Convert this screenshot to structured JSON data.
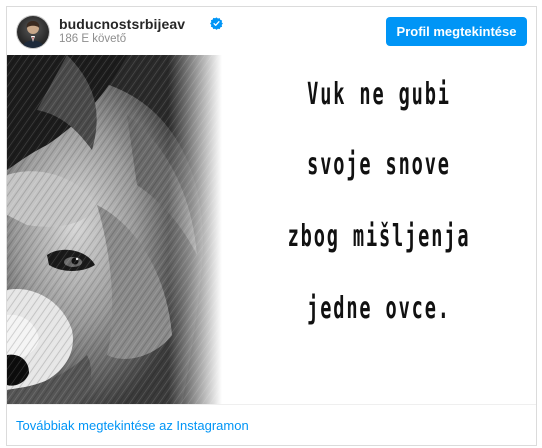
{
  "header": {
    "username": "buducnostsrbijeav",
    "followers": "186 E követő",
    "profile_button": "Profil megtekintése"
  },
  "post": {
    "quote_lines": [
      "Vuk ne gubi",
      "svoje snove",
      "zbog mišljenja",
      "jedne ovce."
    ]
  },
  "footer": {
    "link": "Továbbiak megtekintése az Instagramon"
  },
  "colors": {
    "accent": "#0095f6",
    "text": "#262626",
    "muted": "#8e8e8e",
    "border": "#dbdbdb"
  },
  "icons": {
    "verified": "verified-badge-icon"
  }
}
